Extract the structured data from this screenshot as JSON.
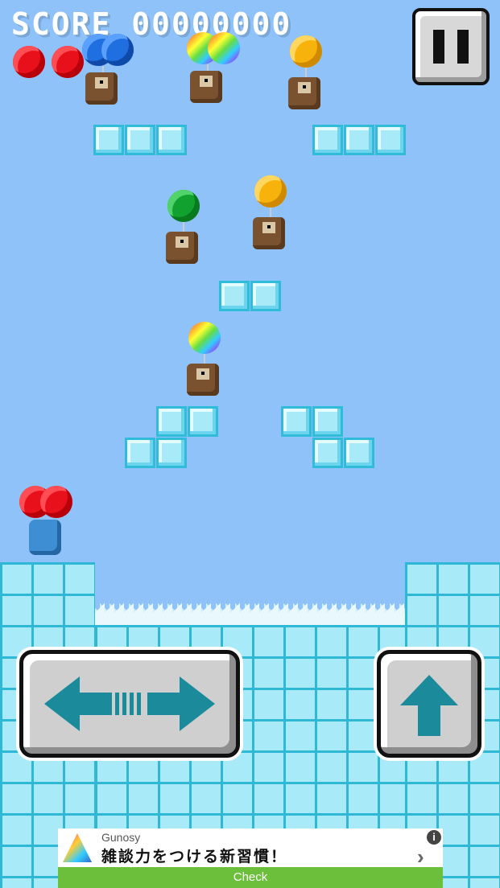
{
  "hud": {
    "score_label": "SCORE",
    "score_value": "00000000",
    "lives_remaining": 2,
    "pause_icon": "pause-icon"
  },
  "colors": {
    "sky": "#8fc2f9",
    "block_fill": "#a8eaf7",
    "block_border": "#30bcd8",
    "control_arrow": "#1b8b9c",
    "ad_button": "#6cbf3a"
  },
  "controls": {
    "move_icon": "left-right-arrow-icon",
    "jump_icon": "up-arrow-icon"
  },
  "ad": {
    "brand": "Gunosy",
    "headline": "雑談力をつける新習慣！",
    "button_label": "Check",
    "info_icon": "info-icon",
    "chevron_icon": "chevron-right-icon"
  }
}
